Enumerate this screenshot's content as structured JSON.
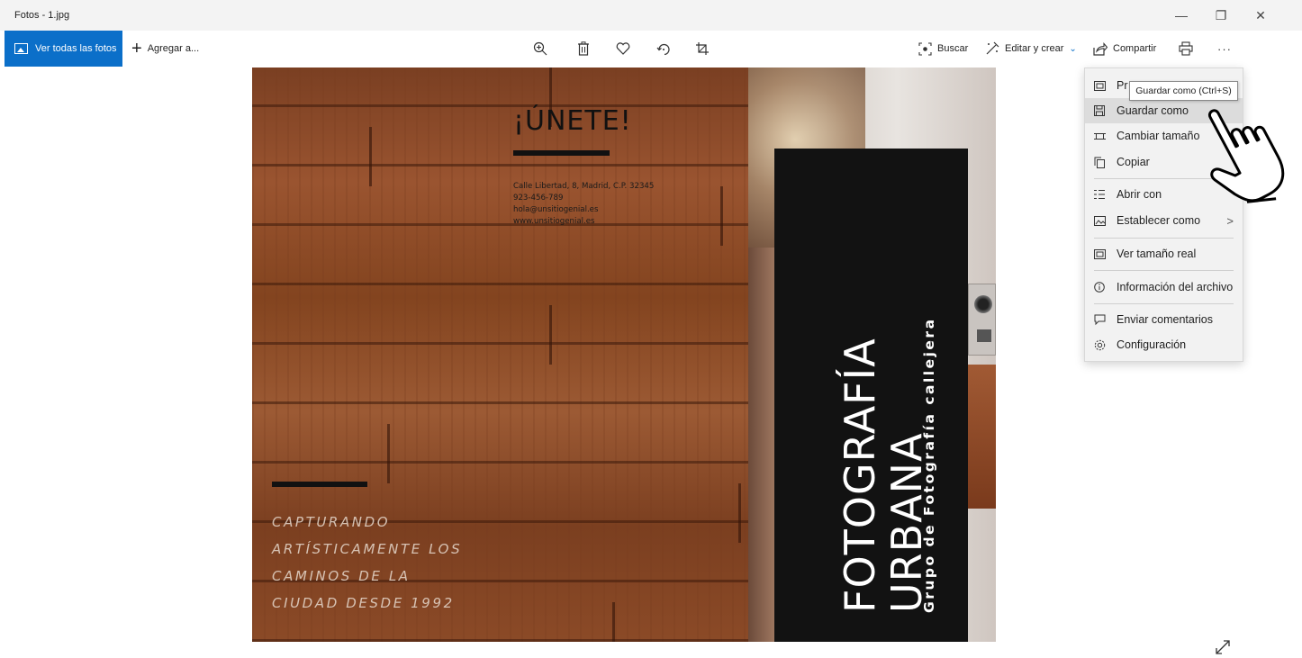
{
  "window": {
    "title": "Fotos - 1.jpg",
    "minimize_glyph": "—",
    "maximize_glyph": "❐",
    "close_glyph": "✕"
  },
  "toolbar": {
    "view_all_label": "Ver todas las fotos",
    "add_label": "Agregar a...",
    "search_label": "Buscar",
    "edit_create_label": "Editar y crear",
    "share_label": "Compartir",
    "more_glyph": "···",
    "icons": [
      "zoom-icon",
      "delete-icon",
      "favorite-icon",
      "rotate-icon",
      "crop-icon",
      "print-icon"
    ]
  },
  "photo": {
    "headline": "¡ÚNETE!",
    "contact": {
      "address": "Calle Libertad, 8, Madrid, C.P. 32345",
      "phone": "923-456-789",
      "email": "hola@unsitiogenial.es",
      "web": "www.unsitiogenial.es"
    },
    "tagline": [
      "CAPTURANDO",
      "ARTÍSTICAMENTE LOS",
      "CAMINOS DE LA",
      "CIUDAD DESDE 1992"
    ],
    "title_line1": "FOTOGRAFÍA",
    "title_line2": "URBANA",
    "subtitle": "Grupo de Fotografía callejera"
  },
  "menu": {
    "items": [
      {
        "label": "Pr",
        "icon": "slideshow-icon"
      },
      {
        "label": "Guardar como",
        "icon": "save-icon",
        "highlighted": true
      },
      {
        "label": "Cambiar tamaño",
        "icon": "resize-icon"
      },
      {
        "label": "Copiar",
        "icon": "copy-icon"
      },
      {
        "label": "Abrir con",
        "icon": "open-with-icon"
      },
      {
        "label": "Establecer como",
        "icon": "set-as-icon",
        "submenu": true
      },
      {
        "label": "Ver tamaño real",
        "icon": "actual-size-icon"
      },
      {
        "label": "Información del archivo",
        "icon": "info-icon"
      },
      {
        "label": "Enviar comentarios",
        "icon": "feedback-icon"
      },
      {
        "label": "Configuración",
        "icon": "settings-icon"
      }
    ],
    "submenu_arrow": ">"
  },
  "tooltip": "Guardar como (Ctrl+S)",
  "colors": {
    "accent": "#0b6fc9",
    "menu_bg": "#f2f2f2",
    "menu_highlight": "#dcdcdc"
  }
}
